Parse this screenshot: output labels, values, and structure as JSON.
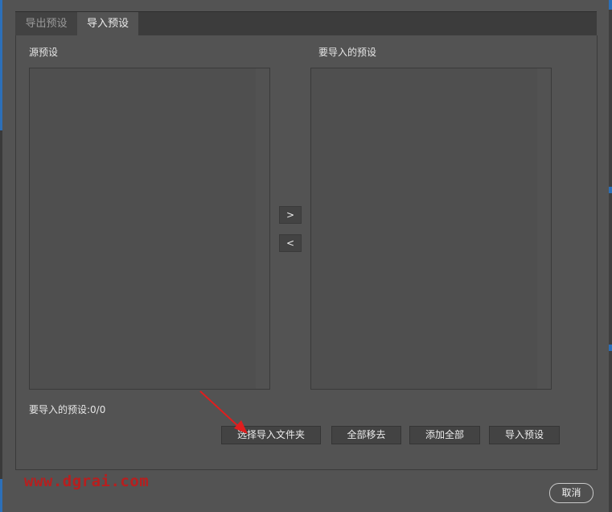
{
  "tabs": [
    {
      "label": "导出预设",
      "active": false
    },
    {
      "label": "导入预设",
      "active": true
    }
  ],
  "source": {
    "label": "源预设"
  },
  "target": {
    "label": "要导入的预设"
  },
  "arrows": {
    "add": ">",
    "remove": "<"
  },
  "status": {
    "text": "要导入的预设:0/0"
  },
  "actions": {
    "select_folder": "选择导入文件夹",
    "remove_all": "全部移去",
    "add_all": "添加全部",
    "import": "导入预设"
  },
  "footer": {
    "watermark": "www.dgrai.com",
    "cancel": "取消"
  },
  "colors": {
    "background": "#535353",
    "accent_arrow": "#e01e1e",
    "watermark": "#b71f1f"
  }
}
